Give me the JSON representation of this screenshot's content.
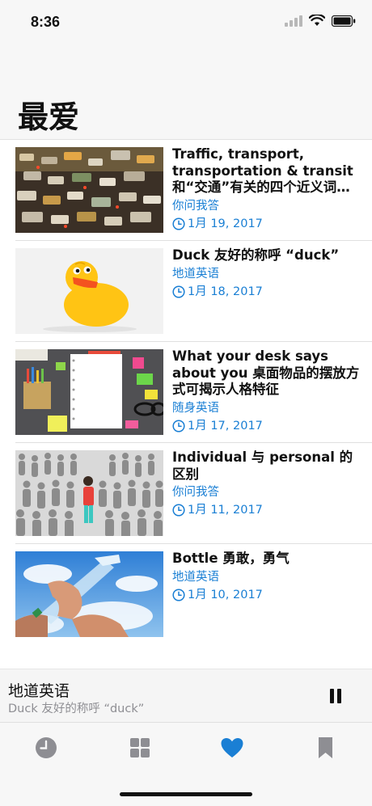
{
  "status_bar": {
    "time": "8:36"
  },
  "header": {
    "title": "最爱"
  },
  "favorites": [
    {
      "title": "Traffic, transport, transportation & transit 和“交通”有关的四个近义词…",
      "category": "你问我答",
      "date": "1月 19, 2017",
      "image": "traffic-jam-photo"
    },
    {
      "title": "Duck 友好的称呼 “duck”",
      "category": "地道英语",
      "date": "1月 18, 2017",
      "image": "rubber-duck-photo"
    },
    {
      "title": "What your desk says about you 桌面物品的摆放方式可揭示人格特征",
      "category": "随身英语",
      "date": "1月 17, 2017",
      "image": "desk-supplies-photo"
    },
    {
      "title": "Individual 与 personal 的区别",
      "category": "你问我答",
      "date": "1月 11, 2017",
      "image": "crowd-individual-photo"
    },
    {
      "title": "Bottle 勇敢，勇气",
      "category": "地道英语",
      "date": "1月 10, 2017",
      "image": "drinking-bottle-photo"
    }
  ],
  "mini_player": {
    "title": "地道英语",
    "subtitle": "Duck 友好的称呼 “duck”"
  },
  "tabs": [
    {
      "name": "recent",
      "icon": "clock-icon",
      "active": false
    },
    {
      "name": "programs",
      "icon": "grid-icon",
      "active": false
    },
    {
      "name": "favorites",
      "icon": "heart-icon",
      "active": true
    },
    {
      "name": "bookmarks",
      "icon": "bookmark-icon",
      "active": false
    }
  ],
  "colors": {
    "accent": "#1a7fd4",
    "inactive_tab": "#8e8e93"
  }
}
